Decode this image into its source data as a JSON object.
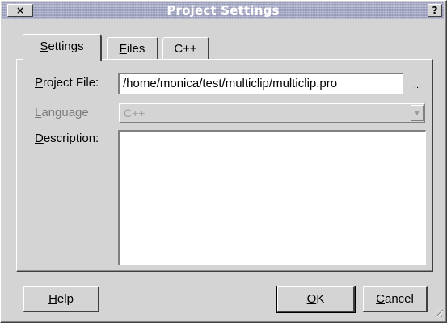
{
  "window": {
    "title": "Project Settings",
    "close_glyph": "×",
    "help_glyph": "?"
  },
  "tabs": [
    {
      "label_access": "S",
      "label_rest": "ettings",
      "active": true
    },
    {
      "label_access": "F",
      "label_rest": "iles",
      "active": false
    },
    {
      "label_access": "",
      "label_rest": "C++",
      "active": false
    }
  ],
  "form": {
    "project_file": {
      "label_access": "P",
      "label_rest": "roject File:",
      "value": "/home/monica/test/multiclip/multiclip.pro",
      "browse_label": "..."
    },
    "language": {
      "label_access": "L",
      "label_rest": "anguage",
      "value": "C++",
      "arrow_glyph": "▼"
    },
    "description": {
      "label_access": "D",
      "label_rest": "escription:",
      "value": ""
    }
  },
  "buttons": {
    "help": {
      "access": "H",
      "rest": "elp"
    },
    "ok": {
      "access": "O",
      "rest": "K"
    },
    "cancel": {
      "access": "C",
      "rest": "ancel"
    }
  }
}
